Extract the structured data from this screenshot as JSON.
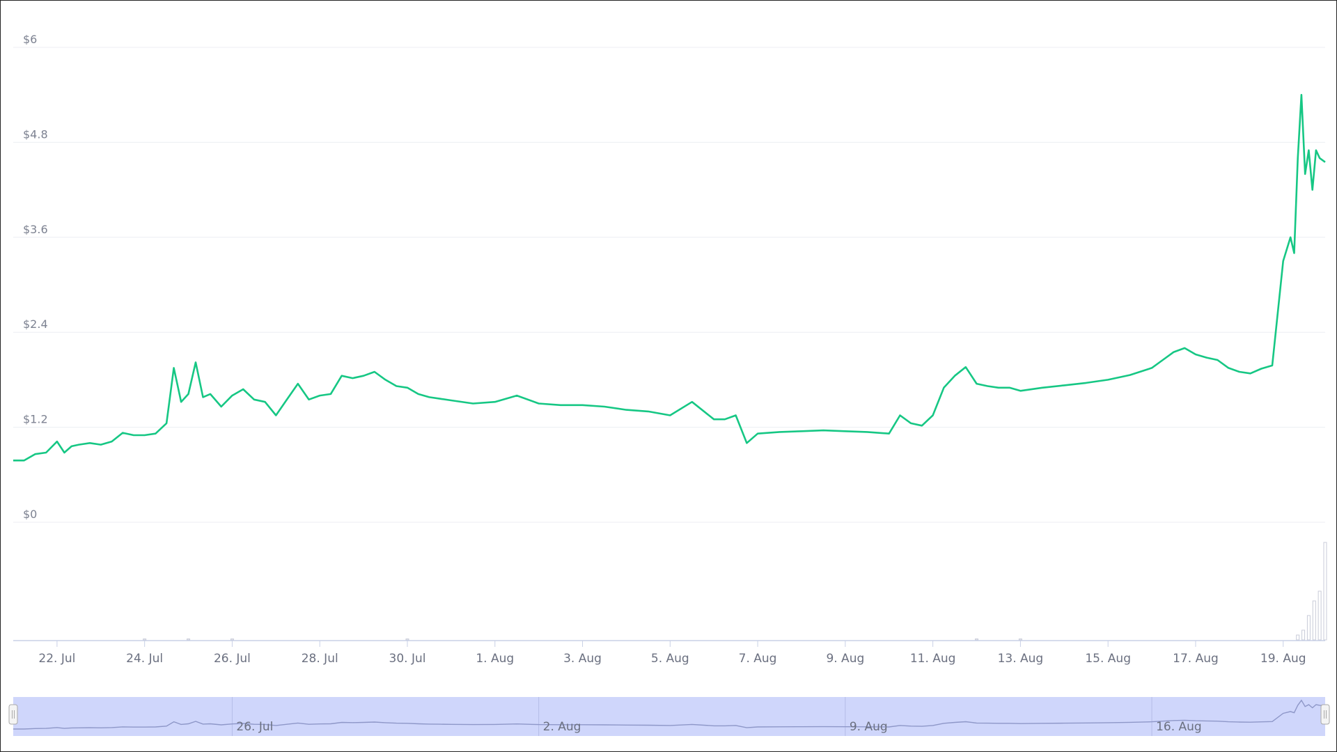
{
  "chart_data": {
    "type": "line",
    "title": "",
    "xlabel": "",
    "ylabel": "",
    "x_start": "2020-07-21",
    "x_end": "2020-08-19T23:00",
    "ylim": [
      0,
      6
    ],
    "yticks": [
      0,
      1.2,
      2.4,
      3.6,
      4.8,
      6
    ],
    "ytick_labels": [
      "$0",
      "$1.2",
      "$2.4",
      "$3.6",
      "$4.8",
      "$6"
    ],
    "xticks": [
      "2020-07-22",
      "2020-07-24",
      "2020-07-26",
      "2020-07-28",
      "2020-07-30",
      "2020-08-01",
      "2020-08-03",
      "2020-08-05",
      "2020-08-07",
      "2020-08-09",
      "2020-08-11",
      "2020-08-13",
      "2020-08-15",
      "2020-08-17",
      "2020-08-19"
    ],
    "xtick_labels": [
      "22. Jul",
      "24. Jul",
      "26. Jul",
      "28. Jul",
      "30. Jul",
      "1. Aug",
      "3. Aug",
      "5. Aug",
      "7. Aug",
      "9. Aug",
      "11. Aug",
      "13. Aug",
      "15. Aug",
      "17. Aug",
      "19. Aug"
    ],
    "grid": true,
    "line_color": "#16c784",
    "volume_color": "#c8cbd8",
    "navigator_fill": "#cfd6fb",
    "navigator_line": "#8e97c8",
    "navigator_ticks": [
      "2020-07-26",
      "2020-08-02",
      "2020-08-09",
      "2020-08-16"
    ],
    "navigator_tick_labels": [
      "26. Jul",
      "2. Aug",
      "9. Aug",
      "16. Aug"
    ],
    "series": [
      {
        "x": [
          "2020-07-21T00:00",
          "2020-07-21T06:00",
          "2020-07-21T12:00",
          "2020-07-21T18:00",
          "2020-07-22T00:00",
          "2020-07-22T04:00",
          "2020-07-22T08:00",
          "2020-07-22T12:00",
          "2020-07-22T18:00",
          "2020-07-23T00:00",
          "2020-07-23T06:00",
          "2020-07-23T12:00",
          "2020-07-23T18:00",
          "2020-07-24T00:00",
          "2020-07-24T06:00",
          "2020-07-24T12:00",
          "2020-07-24T16:00",
          "2020-07-24T20:00",
          "2020-07-25T00:00",
          "2020-07-25T04:00",
          "2020-07-25T08:00",
          "2020-07-25T12:00",
          "2020-07-25T18:00",
          "2020-07-26T00:00",
          "2020-07-26T06:00",
          "2020-07-26T12:00",
          "2020-07-26T18:00",
          "2020-07-27T00:00",
          "2020-07-27T06:00",
          "2020-07-27T12:00",
          "2020-07-27T18:00",
          "2020-07-28T00:00",
          "2020-07-28T06:00",
          "2020-07-28T12:00",
          "2020-07-28T18:00",
          "2020-07-29T00:00",
          "2020-07-29T06:00",
          "2020-07-29T12:00",
          "2020-07-29T18:00",
          "2020-07-30T00:00",
          "2020-07-30T06:00",
          "2020-07-30T12:00",
          "2020-07-30T18:00",
          "2020-07-31T00:00",
          "2020-07-31T12:00",
          "2020-08-01T00:00",
          "2020-08-01T12:00",
          "2020-08-02T00:00",
          "2020-08-02T12:00",
          "2020-08-03T00:00",
          "2020-08-03T12:00",
          "2020-08-04T00:00",
          "2020-08-04T12:00",
          "2020-08-05T00:00",
          "2020-08-05T12:00",
          "2020-08-06T00:00",
          "2020-08-06T06:00",
          "2020-08-06T12:00",
          "2020-08-06T18:00",
          "2020-08-07T00:00",
          "2020-08-07T12:00",
          "2020-08-08T00:00",
          "2020-08-08T12:00",
          "2020-08-09T00:00",
          "2020-08-09T12:00",
          "2020-08-10T00:00",
          "2020-08-10T06:00",
          "2020-08-10T12:00",
          "2020-08-10T18:00",
          "2020-08-11T00:00",
          "2020-08-11T06:00",
          "2020-08-11T12:00",
          "2020-08-11T18:00",
          "2020-08-12T00:00",
          "2020-08-12T06:00",
          "2020-08-12T12:00",
          "2020-08-12T18:00",
          "2020-08-13T00:00",
          "2020-08-13T12:00",
          "2020-08-14T00:00",
          "2020-08-14T12:00",
          "2020-08-15T00:00",
          "2020-08-15T12:00",
          "2020-08-16T00:00",
          "2020-08-16T06:00",
          "2020-08-16T12:00",
          "2020-08-16T18:00",
          "2020-08-17T00:00",
          "2020-08-17T06:00",
          "2020-08-17T12:00",
          "2020-08-17T18:00",
          "2020-08-18T00:00",
          "2020-08-18T06:00",
          "2020-08-18T12:00",
          "2020-08-18T18:00",
          "2020-08-19T00:00",
          "2020-08-19T04:00",
          "2020-08-19T06:00",
          "2020-08-19T08:00",
          "2020-08-19T10:00",
          "2020-08-19T12:00",
          "2020-08-19T14:00",
          "2020-08-19T16:00",
          "2020-08-19T18:00",
          "2020-08-19T20:00",
          "2020-08-19T23:00"
        ],
        "values": [
          0.78,
          0.78,
          0.86,
          0.88,
          1.02,
          0.88,
          0.96,
          0.98,
          1.0,
          0.98,
          1.02,
          1.13,
          1.1,
          1.1,
          1.12,
          1.25,
          1.95,
          1.52,
          1.62,
          2.02,
          1.58,
          1.62,
          1.46,
          1.6,
          1.68,
          1.55,
          1.52,
          1.35,
          1.55,
          1.75,
          1.55,
          1.6,
          1.62,
          1.85,
          1.82,
          1.85,
          1.9,
          1.8,
          1.72,
          1.7,
          1.62,
          1.58,
          1.56,
          1.54,
          1.5,
          1.52,
          1.6,
          1.5,
          1.48,
          1.48,
          1.46,
          1.42,
          1.4,
          1.35,
          1.52,
          1.3,
          1.3,
          1.35,
          1.0,
          1.12,
          1.14,
          1.15,
          1.16,
          1.15,
          1.14,
          1.12,
          1.35,
          1.25,
          1.22,
          1.35,
          1.7,
          1.85,
          1.96,
          1.75,
          1.72,
          1.7,
          1.7,
          1.66,
          1.7,
          1.73,
          1.76,
          1.8,
          1.86,
          1.95,
          2.05,
          2.15,
          2.2,
          2.12,
          2.08,
          2.05,
          1.95,
          1.9,
          1.88,
          1.94,
          1.98,
          3.3,
          3.6,
          3.4,
          4.6,
          5.4,
          4.4,
          4.7,
          4.2,
          4.7,
          4.6,
          4.55
        ]
      }
    ],
    "volume": {
      "x": [
        "2020-07-24T00:00",
        "2020-07-25T00:00",
        "2020-07-26T00:00",
        "2020-07-30T00:00",
        "2020-08-12T00:00",
        "2020-08-13T00:00",
        "2020-08-19T08:00",
        "2020-08-19T11:00",
        "2020-08-19T14:00",
        "2020-08-19T17:00",
        "2020-08-19T20:00",
        "2020-08-19T23:00"
      ],
      "values": [
        0.01,
        0.01,
        0.01,
        0.01,
        0.01,
        0.01,
        0.05,
        0.1,
        0.25,
        0.4,
        0.5,
        1.0
      ]
    }
  }
}
